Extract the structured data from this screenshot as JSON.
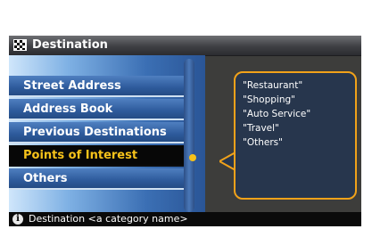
{
  "header": {
    "title": "Destination",
    "icon": "checkered-flag-icon"
  },
  "menu": {
    "items": [
      {
        "label": "Street Address",
        "selected": false
      },
      {
        "label": "Address Book",
        "selected": false
      },
      {
        "label": "Previous Destinations",
        "selected": false
      },
      {
        "label": "Points of Interest",
        "selected": true
      },
      {
        "label": "Others",
        "selected": false
      }
    ]
  },
  "callout": {
    "lines": [
      "\"Restaurant\"",
      "\"Shopping\"",
      "\"Auto Service\"",
      "\"Travel\"",
      "\"Others\""
    ]
  },
  "status": {
    "text": "Destination <a category name>",
    "icon": "info-icon"
  },
  "colors": {
    "accent": "#f6c21a",
    "callout_border": "#f1a21a",
    "menu_blue": "#2e5b9c",
    "background": "#3d3d3b"
  }
}
